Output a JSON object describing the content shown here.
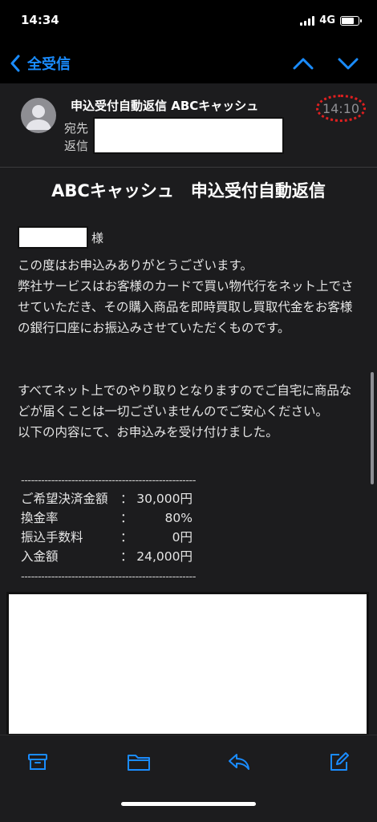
{
  "status": {
    "time": "14:34",
    "network": "4G",
    "signal_bars": 4,
    "battery_level": 0.8
  },
  "nav": {
    "back_label": "全受信",
    "up_icon": "chevron-up-icon",
    "down_icon": "chevron-down-icon"
  },
  "header": {
    "subject": "申込受付自動返信 ABCキャッシュ",
    "to_label": "宛先",
    "reply_label": "返信",
    "time": "14:10"
  },
  "body": {
    "title": "ABCキャッシュ　申込受付自動返信",
    "sama": "様",
    "p1": "この度はお申込みありがとうございます。\n弊社サービスはお客様のカードで買い物代行をネット上でさせていただき、その購入商品を即時買取し買取代金をお客様の銀行口座にお振込みさせていただくものです。",
    "p2": "すべてネット上でのやり取りとなりますのでご自宅に商品などが届くことは一切ございませんのでご安心ください。\n以下の内容にて、お申込みを受け付けました。",
    "divider": "----------------------------------------------------",
    "rows": [
      {
        "label": "ご希望決済金額",
        "colon": "：",
        "value": "30,000円"
      },
      {
        "label": "換金率",
        "colon": "：",
        "value": "80%"
      },
      {
        "label": "振込手数料",
        "colon": "：",
        "value": "0円"
      },
      {
        "label": "入金額",
        "colon": "：",
        "value": "24,000円"
      }
    ]
  },
  "toolbar": {
    "icons": [
      "archive-icon",
      "folder-icon",
      "reply-icon",
      "compose-icon"
    ]
  },
  "colors": {
    "accent": "#1a8cff",
    "background": "#1c1c1e",
    "highlight": "#e02020"
  }
}
